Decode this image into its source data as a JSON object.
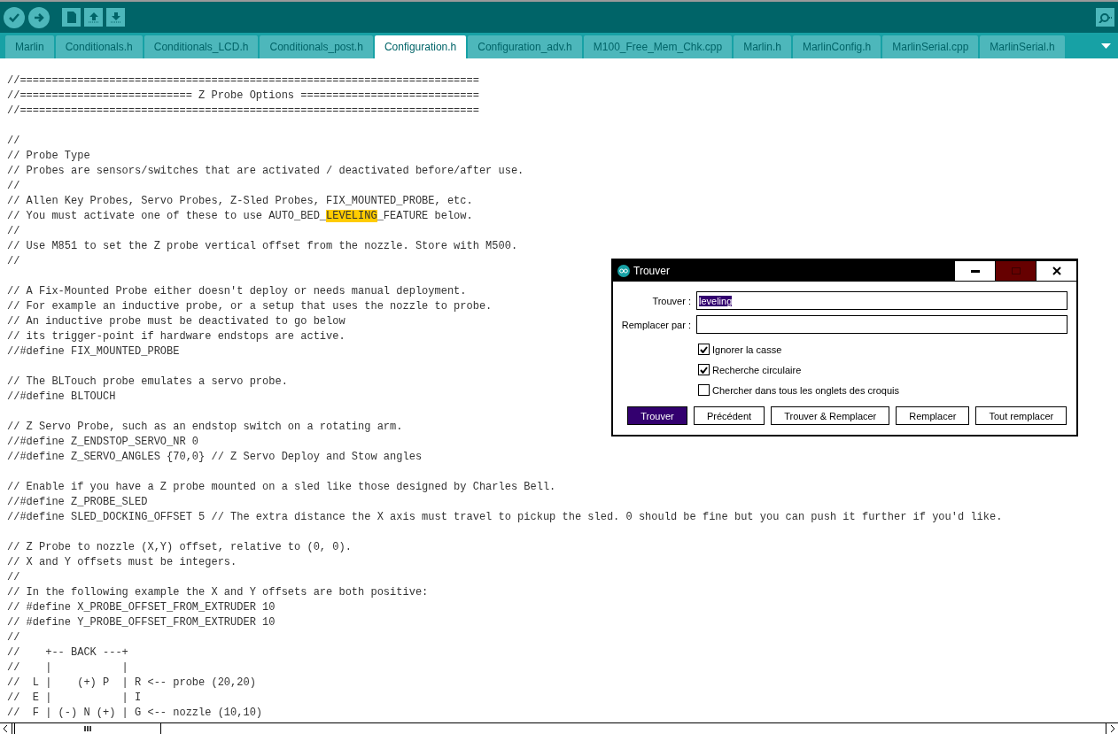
{
  "tabs": [
    {
      "label": "Marlin",
      "selected": false
    },
    {
      "label": "Conditionals.h",
      "selected": false
    },
    {
      "label": "Conditionals_LCD.h",
      "selected": false
    },
    {
      "label": "Conditionals_post.h",
      "selected": false
    },
    {
      "label": "Configuration.h",
      "selected": true
    },
    {
      "label": "Configuration_adv.h",
      "selected": false
    },
    {
      "label": "M100_Free_Mem_Chk.cpp",
      "selected": false
    },
    {
      "label": "Marlin.h",
      "selected": false
    },
    {
      "label": "MarlinConfig.h",
      "selected": false
    },
    {
      "label": "MarlinSerial.cpp",
      "selected": false
    },
    {
      "label": "MarlinSerial.h",
      "selected": false
    }
  ],
  "editor": {
    "blocks": [
      [
        "//========================================================================",
        "//=========================== Z Probe Options ============================",
        "//========================================================================"
      ],
      [
        "//",
        "// Probe Type",
        "// Probes are sensors/switches that are activated / deactivated before/after use.",
        "//",
        "// Allen Key Probes, Servo Probes, Z-Sled Probes, FIX_MOUNTED_PROBE, etc.",
        {
          "kind": "match",
          "parts": [
            {
              "text": "// You must activate one of these to use AUTO_BED_",
              "found": false
            },
            {
              "text": "LEVELING",
              "found": true
            },
            {
              "text": "_FEATURE below.",
              "found": false
            }
          ]
        },
        "//",
        "// Use M851 to set the Z probe vertical offset from the nozzle. Store with M500.",
        "//"
      ],
      [
        "// A Fix-Mounted Probe either doesn't deploy or needs manual deployment.",
        "// For example an inductive probe, or a setup that uses the nozzle to probe.",
        "// An inductive probe must be deactivated to go below",
        "// its trigger-point if hardware endstops are active.",
        "//#define FIX_MOUNTED_PROBE"
      ],
      [
        "// The BLTouch probe emulates a servo probe.",
        "//#define BLTOUCH"
      ],
      [
        "// Z Servo Probe, such as an endstop switch on a rotating arm.",
        "//#define Z_ENDSTOP_SERVO_NR 0",
        "//#define Z_SERVO_ANGLES {70,0} // Z Servo Deploy and Stow angles"
      ],
      [
        "// Enable if you have a Z probe mounted on a sled like those designed by Charles Bell.",
        "//#define Z_PROBE_SLED",
        "//#define SLED_DOCKING_OFFSET 5 // The extra distance the X axis must travel to pickup the sled. 0 should be fine but you can push it further if you'd like."
      ],
      [
        "// Z Probe to nozzle (X,Y) offset, relative to (0, 0).",
        "// X and Y offsets must be integers.",
        "//",
        "// In the following example the X and Y offsets are both positive:",
        "// #define X_PROBE_OFFSET_FROM_EXTRUDER 10",
        "// #define Y_PROBE_OFFSET_FROM_EXTRUDER 10",
        "//",
        "//    +-- BACK ---+",
        "//    |           |",
        "//  L |    (+) P  | R <-- probe (20,20)",
        "//  E |           | I",
        "//  F | (-) N (+) | G <-- nozzle (10,10)"
      ]
    ]
  },
  "find_dialog": {
    "title": "Trouver",
    "fields": [
      {
        "label": "Trouver :",
        "value": "leveling",
        "selected_text": true
      },
      {
        "label": "Remplacer par :"
      }
    ],
    "options": [
      {
        "label": "Ignorer la casse",
        "checked": true
      },
      {
        "label": "Recherche circulaire",
        "checked": true
      },
      {
        "label": "Chercher dans tous les onglets des croquis",
        "checked": false
      }
    ],
    "buttons": [
      {
        "label": "Trouver",
        "selected": true
      },
      {
        "label": "Précédent",
        "selected": false
      },
      {
        "label": "Trouver & Remplacer",
        "selected": false
      },
      {
        "label": "Remplacer",
        "selected": false
      },
      {
        "label": "Tout remplacer",
        "selected": false
      }
    ]
  }
}
